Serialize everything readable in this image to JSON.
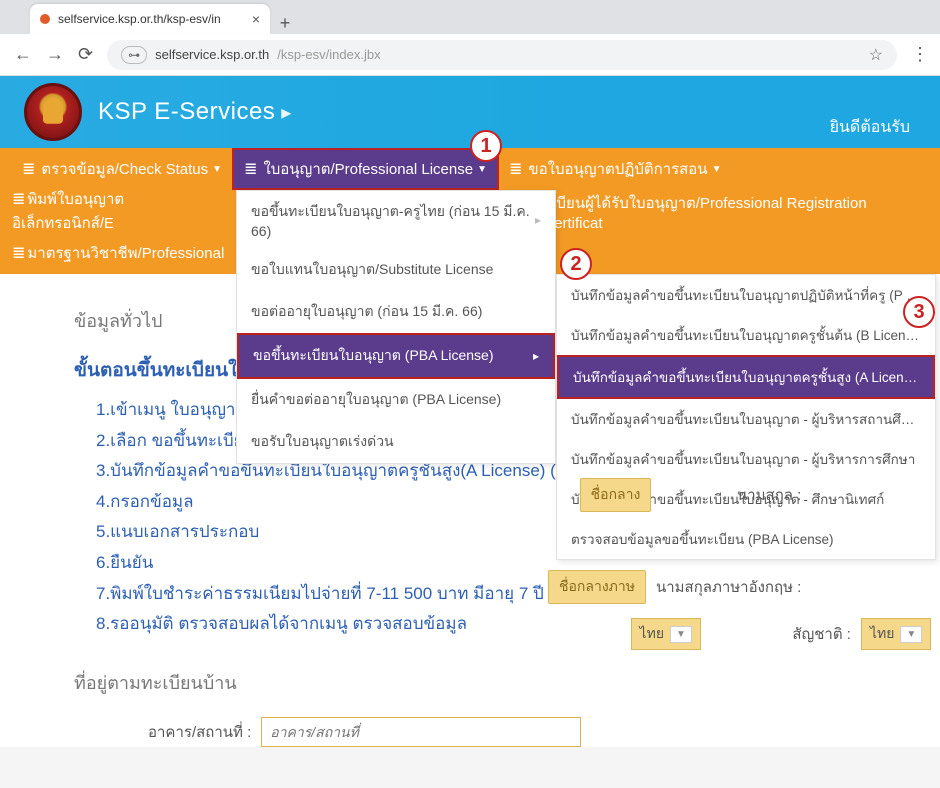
{
  "browser": {
    "tab_title": "selfservice.ksp.or.th/ksp-esv/in",
    "url_host": "selfservice.ksp.or.th",
    "url_path": "/ksp-esv/index.jbx"
  },
  "header": {
    "brand": "KSP E-Services",
    "welcome": "ยินดีต้อนรับ"
  },
  "nav": {
    "row1": {
      "check_status": "ตรวจข้อมูล/Check Status",
      "license": "ใบอนุญาต/Professional License",
      "practice": "ขอใบอนุญาตปฏิบัติการสอน"
    },
    "row2": {
      "print": "พิมพ์ใบอนุญาตอิเล็กทรอนิกส์/E",
      "reg_cert": "ะเบียนผู้ได้รับใบอนุญาต/Professional Registration Certificat"
    },
    "row3": {
      "standards": "มาตรฐานวิชาชีพ/Professional"
    }
  },
  "dropdown": {
    "items": [
      "ขอขึ้นทะเบียนใบอนุญาต-ครูไทย (ก่อน 15 มี.ค. 66)",
      "ขอใบแทนใบอนุญาต/Substitute License",
      "ขอต่ออายุใบอนุญาต (ก่อน 15 มี.ค. 66)",
      "ขอขึ้นทะเบียนใบอนุญาต (PBA License)",
      "ยื่นคำขอต่ออายุใบอนุญาต (PBA License)",
      "ขอรับใบอนุญาตเร่งด่วน"
    ],
    "highlight_index": 3
  },
  "flyout": {
    "items": [
      "บันทึกข้อมูลคำขอขึ้นทะเบียนใบอนุญาตปฏิบัติหน้าที่ครู (P License)",
      "บันทึกข้อมูลคำขอขึ้นทะเบียนใบอนุญาตครูชั้นต้น (B License)",
      "บันทึกข้อมูลคำขอขึ้นทะเบียนใบอนุญาตครูชั้นสูง (A License)",
      "บันทึกข้อมูลคำขอขึ้นทะเบียนใบอนุญาต - ผู้บริหารสถานศึกษา",
      "บันทึกข้อมูลคำขอขึ้นทะเบียนใบอนุญาต - ผู้บริหารการศึกษา",
      "บันทึกข้อมูลคำขอขึ้นทะเบียนใบอนุญาต - ศึกษานิเทศก์",
      "ตรวจสอบข้อมูลขอขึ้นทะเบียน (PBA License)"
    ],
    "highlight_index": 2
  },
  "annotations": {
    "a1": "1",
    "a2": "2",
    "a3": "3"
  },
  "content": {
    "section_general": "ข้อมูลทั่วไป",
    "step_title": "ขั้นตอนขึ้นทะเบียนใบอนุญาตครูชั้นสูง (A License)",
    "steps": [
      "1.เข้าเมนู ใบอนุญาต/Professiosal License (1)",
      "2.เลือก ขอขึ้นทะเบียนใบอนุญาต(PBA License) (2)",
      "3.บันทึกข้อมูลคำขอขึ้นทะเบียนใบอนุญาตครูชั้นสูง(A License) (3)",
      "4.กรอกข้อมูล",
      "5.แนบเอกสารประกอบ",
      "6.ยืนยัน",
      "7.พิมพ์ใบชำระค่าธรรมเนียมไปจ่ายที่ 7-11 500 บาท มีอายุ 7 ปี",
      "8.รออนุมัติ ตรวจสอบผลได้จากเมนู ตรวจสอบข้อมูล"
    ],
    "section_address": "ที่อยู่ตามทะเบียนบ้าน",
    "form": {
      "building_label": "อาคาร/สถานที่ :",
      "building_placeholder": "อาคาร/สถานที่"
    }
  },
  "right": {
    "btn_middle": "ชื่อกลาง",
    "lbl_surname": "นามสกุล :",
    "btn_middle_lang": "ชื่อกลางภาษ",
    "lbl_surname_en": "นามสกุลภาษาอังกฤษ :",
    "sel_country_left": "ไทย",
    "lbl_nationality": "สัญชาติ :",
    "sel_country_right": "ไทย"
  }
}
